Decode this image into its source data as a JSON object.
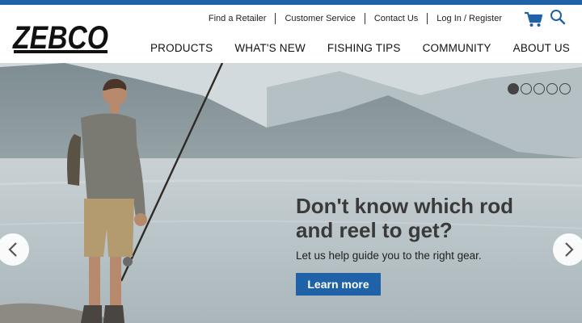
{
  "brand": {
    "logo_text": "ZEBCO",
    "accent_color": "#1f62a8"
  },
  "utility_nav": [
    {
      "label": "Find a Retailer"
    },
    {
      "label": "Customer Service"
    },
    {
      "label": "Contact Us"
    },
    {
      "label": "Log In / Register"
    }
  ],
  "icons": {
    "cart": "cart-icon",
    "search": "search-icon"
  },
  "main_nav": [
    {
      "label": "PRODUCTS"
    },
    {
      "label": "WHAT'S NEW"
    },
    {
      "label": "FISHING TIPS"
    },
    {
      "label": "COMMUNITY"
    },
    {
      "label": "ABOUT US"
    }
  ],
  "hero": {
    "headline": "Don't know which rod and reel to get?",
    "subline": "Let us help guide you to the right gear.",
    "cta_label": "Learn more",
    "slides_total": 5,
    "active_slide": 1
  }
}
